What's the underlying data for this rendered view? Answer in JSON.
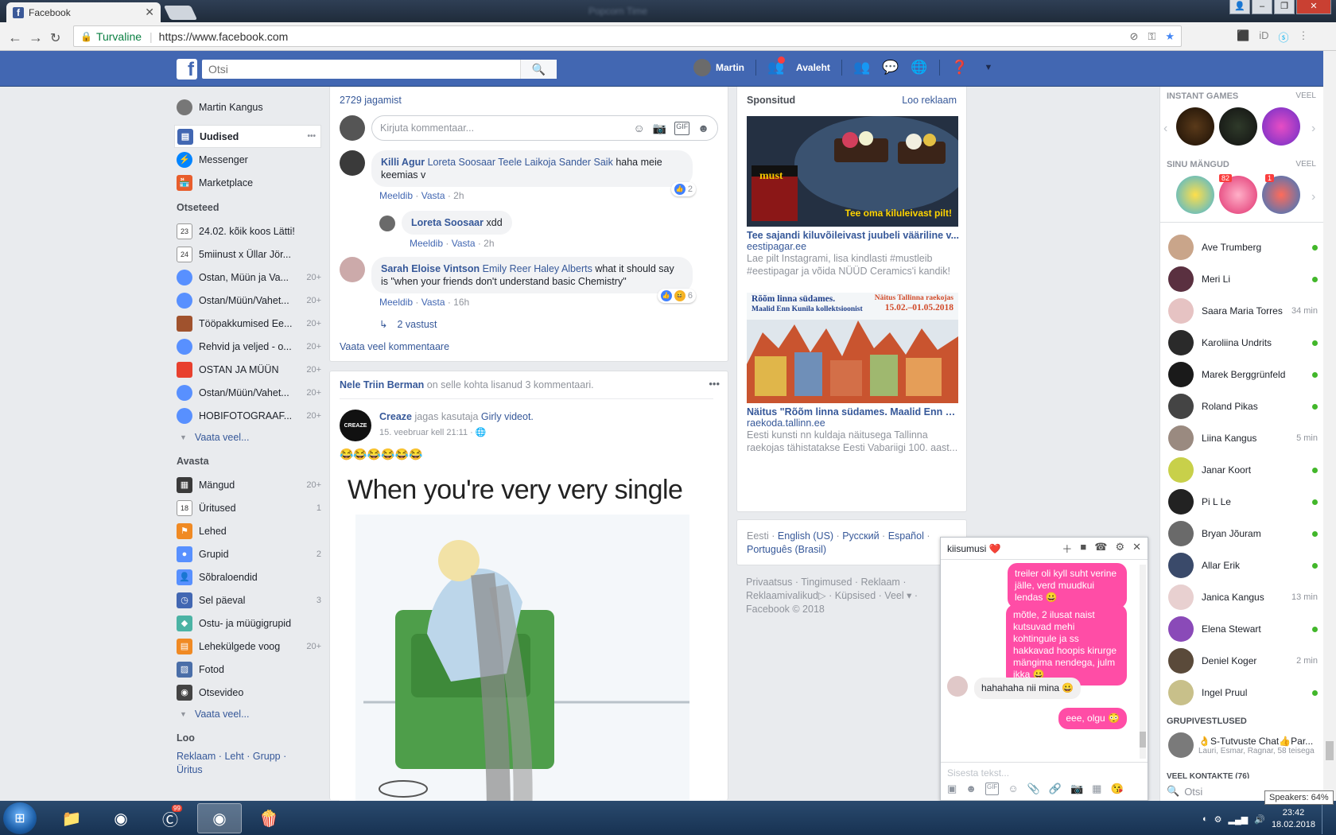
{
  "browser": {
    "tab_title": "Facebook",
    "secure_label": "Turvaline",
    "url": "https://www.facebook.com",
    "window_title": "Popcorn Time"
  },
  "fb_header": {
    "search_placeholder": "Otsi",
    "user_name": "Martin",
    "home_label": "Avaleht"
  },
  "left_nav": {
    "profile_name": "Martin Kangus",
    "main_items": [
      {
        "label": "Uudised",
        "more": "•••"
      },
      {
        "label": "Messenger"
      },
      {
        "label": "Marketplace"
      }
    ],
    "shortcuts_header": "Otseteed",
    "shortcuts": [
      {
        "label": "24.02. kõik koos Lätti!",
        "count": "",
        "icon_text": "23"
      },
      {
        "label": "5miinust x Üllar Jör...",
        "count": "",
        "icon_text": "24"
      },
      {
        "label": "Ostan, Müün ja Va...",
        "count": "20+"
      },
      {
        "label": "Ostan/Müün/Vahet...",
        "count": "20+"
      },
      {
        "label": "Tööpakkumised Ee...",
        "count": "20+"
      },
      {
        "label": "Rehvid ja veljed - o...",
        "count": "20+"
      },
      {
        "label": "OSTAN JA MÜÜN",
        "count": "20+"
      },
      {
        "label": "Ostan/Müün/Vahet...",
        "count": "20+"
      },
      {
        "label": "HOBIFOTOGRAAF...",
        "count": "20+"
      }
    ],
    "see_more": "Vaata veel...",
    "explore_header": "Avasta",
    "explore": [
      {
        "label": "Mängud",
        "count": "20+"
      },
      {
        "label": "Üritused",
        "count": "1",
        "icon_text": "18"
      },
      {
        "label": "Lehed",
        "count": ""
      },
      {
        "label": "Grupid",
        "count": "2"
      },
      {
        "label": "Sõbraloendid",
        "count": ""
      },
      {
        "label": "Sel päeval",
        "count": "3"
      },
      {
        "label": "Ostu- ja müügigrupid",
        "count": ""
      },
      {
        "label": "Lehekülgede voog",
        "count": "20+"
      },
      {
        "label": "Fotod",
        "count": ""
      },
      {
        "label": "Otsevideo",
        "count": ""
      }
    ],
    "see_more2": "Vaata veel...",
    "create_header": "Loo",
    "create_links": [
      "Reklaam",
      "Leht",
      "Grupp",
      "Üritus"
    ]
  },
  "post1": {
    "shares": "2729 jagamist",
    "comment_placeholder": "Kirjuta kommentaar...",
    "comments": [
      {
        "name": "Killi Agur",
        "tags": "Loreta Soosaar Teele Laikoja Sander Saik",
        "text": "haha meie keemias v",
        "like": "Meeldib",
        "reply": "Vasta",
        "time": "2h",
        "reactions": "2"
      },
      {
        "name": "Loreta Soosaar",
        "tags": "",
        "text": "xdd",
        "like": "Meeldib",
        "reply": "Vasta",
        "time": "2h"
      },
      {
        "name": "Sarah Eloise Vintson",
        "tags": "Emily Reer Haley Alberts",
        "text": "what it should say is \"when your friends don't understand basic Chemistry\"",
        "like": "Meeldib",
        "reply": "Vasta",
        "time": "16h",
        "reactions": "6"
      }
    ],
    "replies": "2 vastust",
    "more_comments": "Vaata veel kommentaare"
  },
  "post2": {
    "context_name": "Nele Triin Berman",
    "context_text": "on selle kohta lisanud 3 kommentaari.",
    "page_name": "Creaze",
    "shared_text": "jagas kasutaja",
    "shared_user": "Girly",
    "shared_obj": "videot.",
    "timestamp": "15. veebruar kell 21:11",
    "body": "😂😂😂😂😂😂",
    "meme_caption": "When you're very very single",
    "page_avatar_text": "CREAZE"
  },
  "sponsored": {
    "header": "Sponsitud",
    "create_ad": "Loo reklaam",
    "ad1": {
      "image_caption": "Tee oma kiluleivast pilt!",
      "title": "Tee sajandi kiluvõileivast juubeli vääriline v...",
      "domain": "eestipagar.ee",
      "text": "Lae pilt Instagrami, lisa kindlasti #mustleib #eestipagar ja võida NÜÜD Ceramics'i kandik!",
      "brand": "must"
    },
    "ad2": {
      "image_title": "Rõõm linna südames.",
      "image_subtitle": "Maalid Enn Kunila kollektsioonist",
      "image_venue": "Näitus Tallinna raekojas",
      "image_dates": "15.02.–01.05.2018",
      "title": "Näitus \"Rõõm linna südames. Maalid Enn K...",
      "domain": "raekoda.tallinn.ee",
      "text": "Eesti kunsti nn kuldaja näitusega Tallinna raekojas tähistatakse Eesti Vabariigi 100. aast..."
    }
  },
  "languages": {
    "items": [
      "Eesti",
      "English (US)",
      "Русский",
      "Español",
      "Português (Brasil)"
    ]
  },
  "footer": {
    "links": [
      "Privaatsus",
      "Tingimused",
      "Reklaam",
      "Reklaamivalikud",
      "Küpsised",
      "Veel"
    ],
    "copyright": "Facebook © 2018"
  },
  "chat_sidebar": {
    "games_header": "INSTANT GAMES",
    "games_more": "VEEL",
    "mygames_header": "SINU MÄNGUD",
    "mygames_more": "VEEL",
    "badge_82": "82",
    "badge_1": "1",
    "friends": [
      {
        "name": "Ave Trumberg",
        "status": "online"
      },
      {
        "name": "Meri Li",
        "status": "online"
      },
      {
        "name": "Saara Maria Torres",
        "status": "34 min"
      },
      {
        "name": "Karoliina Undrits",
        "status": "online"
      },
      {
        "name": "Marek Berggrünfeld",
        "status": "online"
      },
      {
        "name": "Roland Pikas",
        "status": "online"
      },
      {
        "name": "Liina Kangus",
        "status": "5 min"
      },
      {
        "name": "Janar Koort",
        "status": "online"
      },
      {
        "name": "Pi L Le",
        "status": "online"
      },
      {
        "name": "Bryan Jõuram",
        "status": "online"
      },
      {
        "name": "Allar Erik",
        "status": "online"
      },
      {
        "name": "Janica Kangus",
        "status": "13 min"
      },
      {
        "name": "Elena Stewart",
        "status": "online"
      },
      {
        "name": "Deniel Koger",
        "status": "2 min"
      },
      {
        "name": "Ingel Pruul",
        "status": "online"
      }
    ],
    "group_header": "GRUPIVESTLUSED",
    "group_name": "👌S-Tutvuste Chat👍Par...",
    "group_members": "Lauri, Esmar, Ragnar, 58 teisega",
    "more_contacts": "VEEL KONTAKTE (76)",
    "search_placeholder": "Otsi"
  },
  "chat_window": {
    "title": "kiisumusi ❤️",
    "messages": [
      {
        "from": "me",
        "text": "treiler oli kyll suht verine jälle, verd muudkui lendas 😀"
      },
      {
        "from": "me",
        "text": "mõtle, 2 ilusat naist kutsuvad mehi kohtingule ja ss hakkavad hoopis kirurge mängima nendega, julm ikka 😀"
      },
      {
        "from": "them",
        "text": "hahahaha nii mina 😀"
      },
      {
        "from": "me",
        "text": "eee, olgu 😳"
      }
    ],
    "input_placeholder": "Sisesta tekst..."
  },
  "taskbar": {
    "time": "23:42",
    "date": "18.02.2018",
    "speaker_tooltip": "Speakers: 64%",
    "notif_badge": "99"
  },
  "colors": {
    "fb_blue": "#4267b2",
    "link": "#365899",
    "chat_pink": "#ff4da6",
    "online_green": "#42b72a"
  }
}
